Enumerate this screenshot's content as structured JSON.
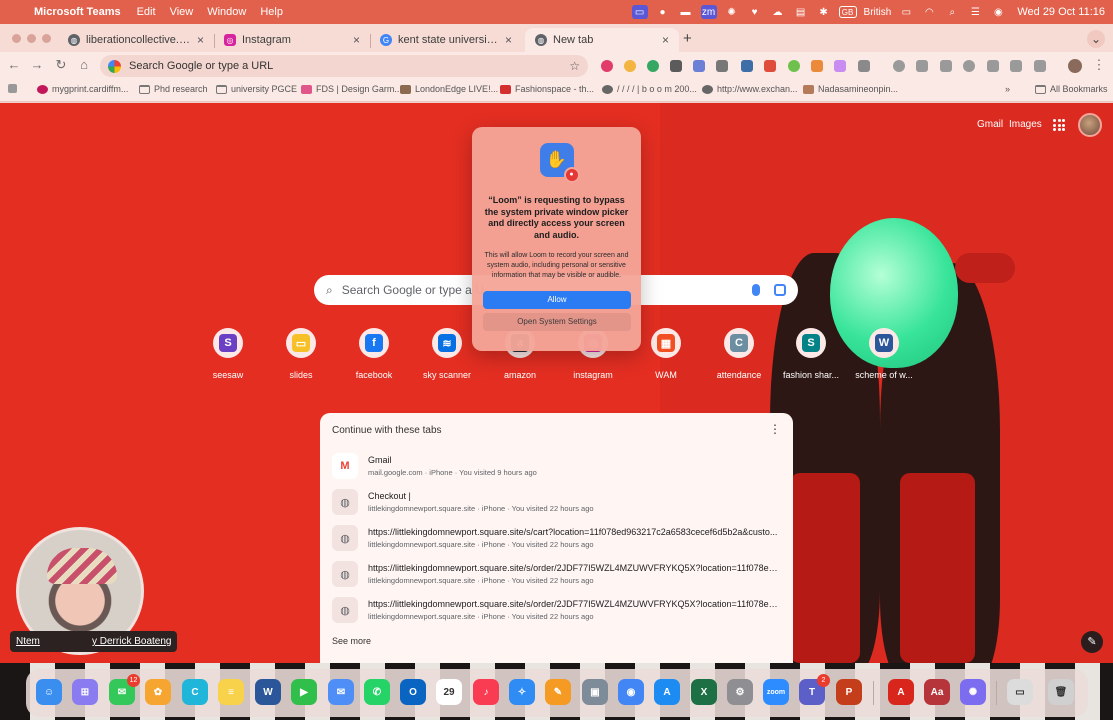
{
  "menubar": {
    "app_name": "Microsoft Teams",
    "menus": [
      "Edit",
      "View",
      "Window",
      "Help"
    ],
    "language": "British",
    "clock": "Wed 29 Oct  11:16"
  },
  "tabs": [
    {
      "title": "liberationcollective.net",
      "active": false
    },
    {
      "title": "Instagram",
      "active": false
    },
    {
      "title": "kent state university museum",
      "active": false
    },
    {
      "title": "New tab",
      "active": true
    }
  ],
  "toolbar": {
    "omnibox_placeholder": "Search Google or type a URL"
  },
  "bookmarks": {
    "items": [
      "mygprint.cardiffm...",
      "Phd research",
      "university PGCE",
      "FDS | Design Garm...",
      "LondonEdge LIVE!...",
      "Fashionspace - th...",
      "/ / / / | b o o m 200...",
      "http://www.exchan...",
      "Nadasamineonpin..."
    ],
    "all_label": "All Bookmarks"
  },
  "ntp": {
    "gmail_label": "Gmail",
    "images_label": "Images",
    "search_placeholder": "Search Google or type a U",
    "shortcuts": [
      {
        "label": "seesaw",
        "icon": "seesaw-icon",
        "color": "#6b3fc4",
        "glyph": "S"
      },
      {
        "label": "slides",
        "icon": "slides-icon",
        "color": "#f6c026",
        "glyph": "▭"
      },
      {
        "label": "facebook",
        "icon": "facebook-icon",
        "color": "#1877f2",
        "glyph": "f"
      },
      {
        "label": "sky scanner",
        "icon": "skyscanner-icon",
        "color": "#0770e3",
        "glyph": "≋"
      },
      {
        "label": "amazon",
        "icon": "amazon-icon",
        "color": "#232f3e",
        "glyph": "a"
      },
      {
        "label": "instagram",
        "icon": "instagram-icon",
        "color": "#d6249f",
        "glyph": "◎"
      },
      {
        "label": "WAM",
        "icon": "wam-icon",
        "color": "#f25022",
        "glyph": "▦"
      },
      {
        "label": "attendance",
        "icon": "attendance-icon",
        "color": "#6c8ea3",
        "glyph": "C"
      },
      {
        "label": "fashion shar...",
        "icon": "sharepoint-icon",
        "color": "#038387",
        "glyph": "S"
      },
      {
        "label": "scheme of w...",
        "icon": "word-icon",
        "color": "#2b579a",
        "glyph": "W"
      }
    ],
    "continue": {
      "heading": "Continue with these tabs",
      "items": [
        {
          "title": "Gmail",
          "meta": "mail.google.com · iPhone · You visited 9 hours ago",
          "icon": "gmail-icon"
        },
        {
          "title": "Checkout |",
          "meta": "littlekingdomnewport.square.site · iPhone · You visited 22 hours ago",
          "icon": "globe-icon"
        },
        {
          "title": "https://littlekingdomnewport.square.site/s/cart?location=11f078ed963217c2a6583cecef6d5b2a&custo...",
          "meta": "littlekingdomnewport.square.site · iPhone · You visited 22 hours ago",
          "icon": "globe-icon"
        },
        {
          "title": "https://littlekingdomnewport.square.site/s/order/2JDF77I5WZL4MZUWVFRYKQ5X?location=11f078ed9...",
          "meta": "littlekingdomnewport.square.site · iPhone · You visited 22 hours ago",
          "icon": "globe-icon"
        },
        {
          "title": "https://littlekingdomnewport.square.site/s/order/2JDF77I5WZL4MZUWVFRYKQ5X?location=11f078ed9...",
          "meta": "littlekingdomnewport.square.site · iPhone · You visited 22 hours ago",
          "icon": "globe-icon"
        }
      ],
      "see_more": "See more"
    }
  },
  "loom_dialog": {
    "title": "“Loom” is requesting to bypass the system private window picker and directly access your screen and audio.",
    "body": "This will allow Loom to record your screen and system audio, including personal or sensitive information that may be visible or audible.",
    "allow_label": "Allow",
    "settings_label": "Open System Settings"
  },
  "webcam": {
    "name_left": "Ntem",
    "name_right": "y Derrick Boateng"
  },
  "dock": {
    "apps": [
      {
        "name": "finder",
        "color": "#3a8ef0",
        "glyph": "☺"
      },
      {
        "name": "launchpad",
        "color": "#8a7cf0",
        "glyph": "⊞"
      },
      {
        "name": "messages",
        "color": "#34c759",
        "glyph": "✉",
        "badge": "12"
      },
      {
        "name": "photos",
        "color": "#f6a531",
        "glyph": "✿"
      },
      {
        "name": "canva",
        "color": "#1fb6d9",
        "glyph": "C"
      },
      {
        "name": "notes",
        "color": "#f7d24a",
        "glyph": "≡"
      },
      {
        "name": "word",
        "color": "#2b579a",
        "glyph": "W"
      },
      {
        "name": "facetime",
        "color": "#2fbf4a",
        "glyph": "▶"
      },
      {
        "name": "mail",
        "color": "#4f8ef7",
        "glyph": "✉"
      },
      {
        "name": "whatsapp",
        "color": "#25d366",
        "glyph": "✆"
      },
      {
        "name": "outlook",
        "color": "#0a64c2",
        "glyph": "O"
      },
      {
        "name": "calendar",
        "color": "#ffffff",
        "glyph": "29"
      },
      {
        "name": "music",
        "color": "#fa3c52",
        "glyph": "♪"
      },
      {
        "name": "safari",
        "color": "#2f8cf5",
        "glyph": "✧"
      },
      {
        "name": "pages",
        "color": "#f59a23",
        "glyph": "✎"
      },
      {
        "name": "preview",
        "color": "#7e8b98",
        "glyph": "▣"
      },
      {
        "name": "chrome",
        "color": "#4285f4",
        "glyph": "◉"
      },
      {
        "name": "app-store",
        "color": "#1c8cf2",
        "glyph": "A"
      },
      {
        "name": "excel",
        "color": "#1d7044",
        "glyph": "X"
      },
      {
        "name": "system-settings",
        "color": "#8e8e93",
        "glyph": "⚙"
      },
      {
        "name": "zoom",
        "color": "#2d8cff",
        "glyph": "zoom"
      },
      {
        "name": "teams",
        "color": "#5b5fc7",
        "glyph": "T",
        "badge": "2"
      },
      {
        "name": "powerpoint",
        "color": "#c43e1c",
        "glyph": "P"
      },
      {
        "name": "acrobat",
        "color": "#d9261c",
        "glyph": "A"
      },
      {
        "name": "dictionary",
        "color": "#b5353a",
        "glyph": "Aa"
      },
      {
        "name": "perplexity",
        "color": "#7c6cf0",
        "glyph": "✺"
      },
      {
        "name": "downloads",
        "color": "#dcdcdc",
        "glyph": "▭"
      },
      {
        "name": "trash",
        "color": "#d0d0d0",
        "glyph": "🗑"
      }
    ]
  }
}
